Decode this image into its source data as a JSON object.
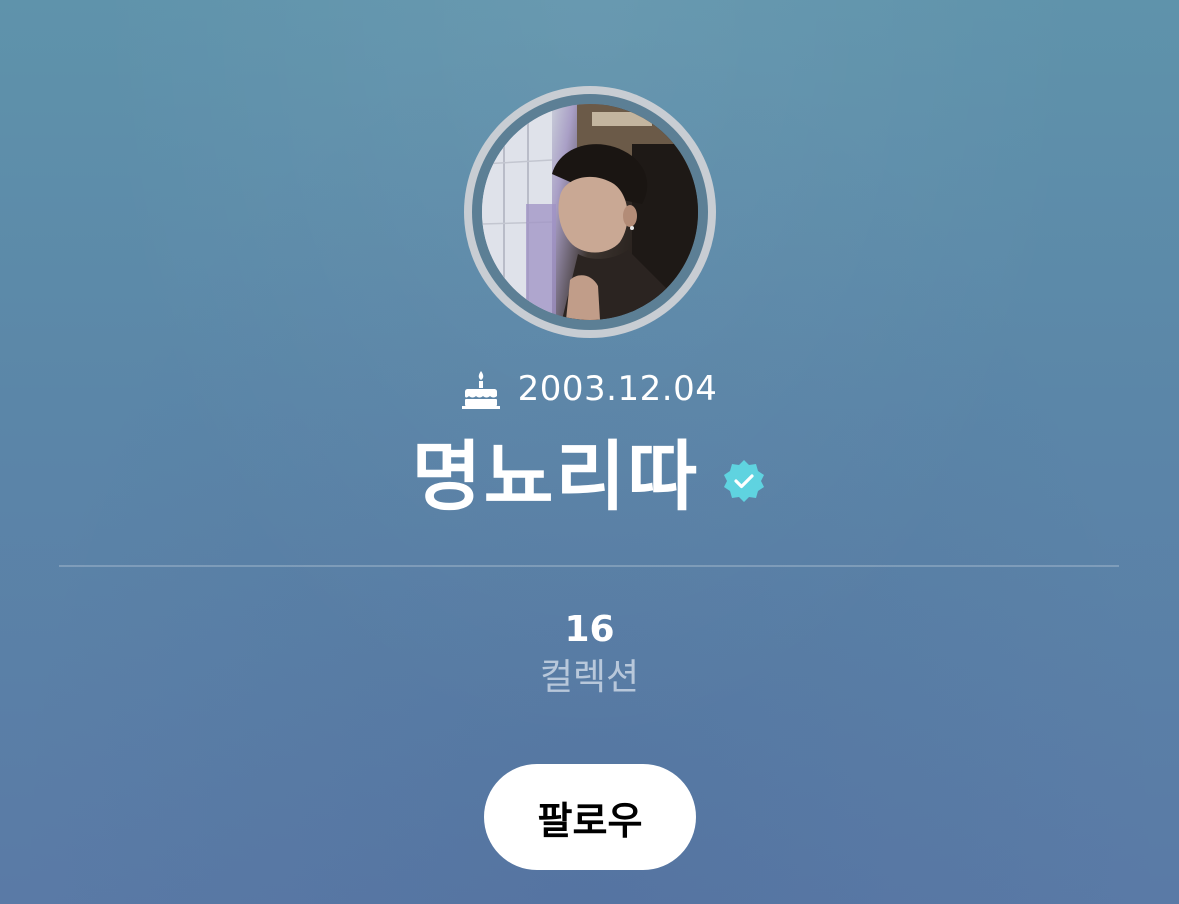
{
  "profile": {
    "birthday": "2003.12.04",
    "name": "명뇨리따",
    "verified": true
  },
  "stats": {
    "count": "16",
    "label": "컬렉션"
  },
  "actions": {
    "follow_label": "팔로우"
  },
  "icons": {
    "birthday": "cake-icon",
    "verified": "verified-badge-icon"
  },
  "colors": {
    "background_top": "#5f93ab",
    "background_bottom": "#5a7aa6",
    "verified_badge": "#5fd3e0",
    "button_bg": "#ffffff",
    "button_text": "#000000"
  }
}
